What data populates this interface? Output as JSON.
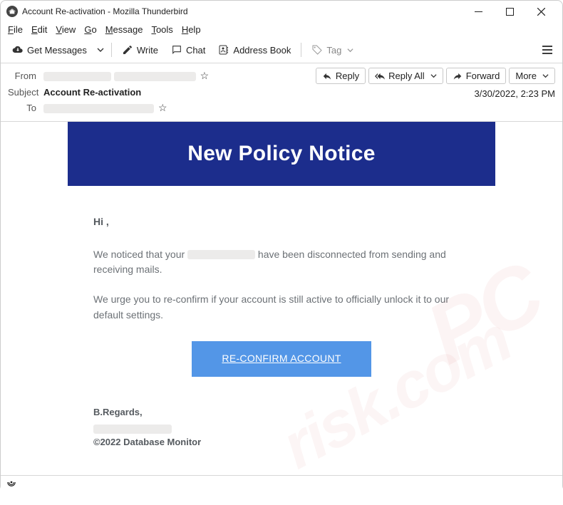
{
  "window": {
    "title": "Account Re-activation - Mozilla Thunderbird"
  },
  "menubar": {
    "file": "File",
    "edit": "Edit",
    "view": "View",
    "go": "Go",
    "message": "Message",
    "tools": "Tools",
    "help": "Help"
  },
  "toolbar": {
    "get_messages": "Get Messages",
    "write": "Write",
    "chat": "Chat",
    "address_book": "Address Book",
    "tag": "Tag"
  },
  "headers": {
    "from_label": "From",
    "subject_label": "Subject",
    "to_label": "To",
    "subject_value": "Account Re-activation",
    "date": "3/30/2022, 2:23 PM",
    "reply": "Reply",
    "reply_all": "Reply All",
    "forward": "Forward",
    "more": "More"
  },
  "email": {
    "banner": "New Policy Notice",
    "greeting": "Hi  ,",
    "p1a": "We noticed that your  ",
    "p1b": "  have been disconnected from sending and receiving mails.",
    "p2": "We urge you to re-confirm if your account is still active  to officially unlock it to our default settings.",
    "cta": "RE-CONFIRM ACCOUNT",
    "sig": "B.Regards,",
    "copy": "©2022  Database Monitor"
  }
}
